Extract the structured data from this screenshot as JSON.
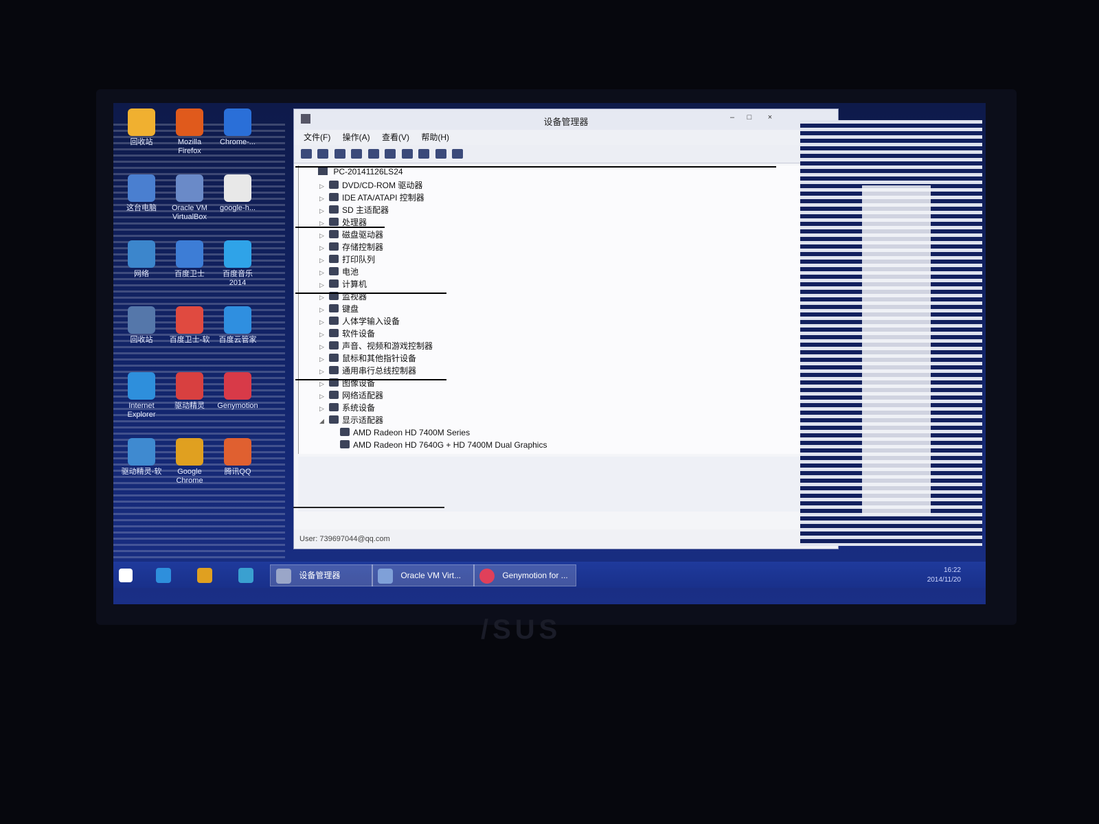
{
  "desktop": {
    "icons": [
      {
        "label": "回收站",
        "color": "#f0b030"
      },
      {
        "label": "Mozilla Firefox",
        "color": "#e05a1c"
      },
      {
        "label": "Chrome-...",
        "color": "#2a6fd8"
      },
      {
        "label": "这台电脑",
        "color": "#4a7fd0"
      },
      {
        "label": "Oracle VM VirtualBox",
        "color": "#6a8ac8"
      },
      {
        "label": "google-h...",
        "color": "#e8e8e8"
      },
      {
        "label": "网络",
        "color": "#3c86cc"
      },
      {
        "label": "百度卫士",
        "color": "#3d7dd6"
      },
      {
        "label": "百度音乐 2014",
        "color": "#2fa3e8"
      },
      {
        "label": "回收站",
        "color": "#5577aa"
      },
      {
        "label": "百度卫士-软",
        "color": "#e04a40"
      },
      {
        "label": "百度云管家",
        "color": "#2f8fe0"
      },
      {
        "label": "Internet Explorer",
        "color": "#2e8fdc"
      },
      {
        "label": "驱动精灵",
        "color": "#d84040"
      },
      {
        "label": "Genymotion",
        "color": "#d83a48"
      },
      {
        "label": "驱动精灵-软",
        "color": "#3f8ad0"
      },
      {
        "label": "Google Chrome",
        "color": "#e0a020"
      },
      {
        "label": "腾讯QQ",
        "color": "#e06030"
      }
    ]
  },
  "window": {
    "title": "设备管理器",
    "menu": [
      "文件(F)",
      "操作(A)",
      "查看(V)",
      "帮助(H)"
    ],
    "win_buttons": [
      "–",
      "□",
      "×"
    ],
    "tree": {
      "root": "PC-20141126LS24",
      "categories": [
        "DVD/CD-ROM 驱动器",
        "IDE ATA/ATAPI 控制器",
        "SD 主适配器",
        "处理器",
        "磁盘驱动器",
        "存储控制器",
        "打印队列",
        "电池",
        "计算机",
        "监视器",
        "键盘",
        "人体学输入设备",
        "软件设备",
        "声音、视频和游戏控制器",
        "鼠标和其他指针设备",
        "通用串行总线控制器",
        "图像设备",
        "网络适配器",
        "系统设备",
        "显示适配器"
      ],
      "expanded_children": [
        "AMD Radeon HD 7400M Series",
        "AMD Radeon HD 7640G + HD 7400M Dual Graphics"
      ]
    },
    "status_user": "User: 739697044@qq.com"
  },
  "taskbar": {
    "tasks": [
      {
        "label": "设备管理器",
        "color": "#9aa6c8"
      },
      {
        "label": "Oracle VM Virt...",
        "color": "#7fa0d8"
      },
      {
        "label": "Genymotion for ...",
        "color": "#e0405a"
      }
    ],
    "pinned": [
      {
        "name": "start",
        "color": "#ffffff"
      },
      {
        "name": "ie",
        "color": "#2e8fdc"
      },
      {
        "name": "chrome",
        "color": "#e0a020"
      },
      {
        "name": "chrome-app",
        "color": "#3aa0d0"
      }
    ],
    "tray_time": "16:22",
    "tray_date": "2014/11/20"
  },
  "brand": "/SUS"
}
